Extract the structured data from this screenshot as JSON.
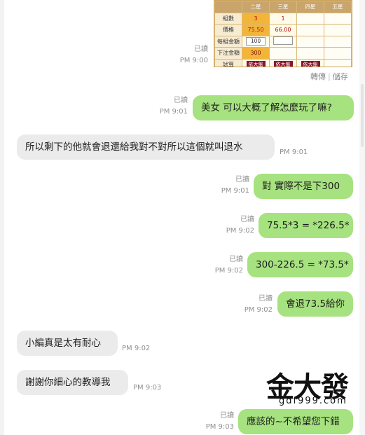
{
  "image_message": {
    "headers": [
      "",
      "二星",
      "三星",
      "四星",
      "五星"
    ],
    "rows": [
      {
        "label": "組數",
        "cells": [
          "3",
          "1",
          "",
          ""
        ]
      },
      {
        "label": "價格",
        "cells": [
          "75.50",
          "66.00",
          "",
          ""
        ]
      },
      {
        "label": "每組金額",
        "cells": [
          "100",
          "",
          "",
          ""
        ]
      },
      {
        "label": "下注金額",
        "cells": [
          "300",
          "",
          "",
          ""
        ]
      },
      {
        "label": "試算",
        "cells": [
          "依大盤",
          "依大盤",
          "依大盤",
          ""
        ]
      }
    ],
    "read": "已讀",
    "time": "PM 9:00",
    "actions": {
      "forward": "轉傳",
      "separator": "|",
      "save": "儲存"
    }
  },
  "messages": [
    {
      "side": "out",
      "text": "美女 可以大概了解怎麼玩了嘛?",
      "read": "已讀",
      "time": "PM 9:01"
    },
    {
      "side": "in",
      "text": "所以剩下的他就會退還給我對不對所以這個就叫退水",
      "time": "PM 9:01"
    },
    {
      "side": "out",
      "text": "對 實際不是下300",
      "read": "已讀",
      "time": "PM 9:01"
    },
    {
      "side": "out",
      "text": "75.5*3 = *226.5*",
      "read": "已讀",
      "time": "PM 9:02"
    },
    {
      "side": "out",
      "text": "300-226.5 = *73.5*",
      "read": "已讀",
      "time": "PM 9:02"
    },
    {
      "side": "out",
      "text": "會退73.5給你",
      "read": "已讀",
      "time": "PM 9:02"
    },
    {
      "side": "in",
      "text": "小編真是太有耐心",
      "time": "PM 9:02"
    },
    {
      "side": "in",
      "text": "謝謝你細心的教導我",
      "time": "PM 9:03"
    },
    {
      "side": "out",
      "text": "應該的~不希望您下錯",
      "read": "已讀",
      "time": "PM 9:03"
    }
  ],
  "watermark": {
    "brand": "金大發",
    "site": "gdf999.com"
  }
}
